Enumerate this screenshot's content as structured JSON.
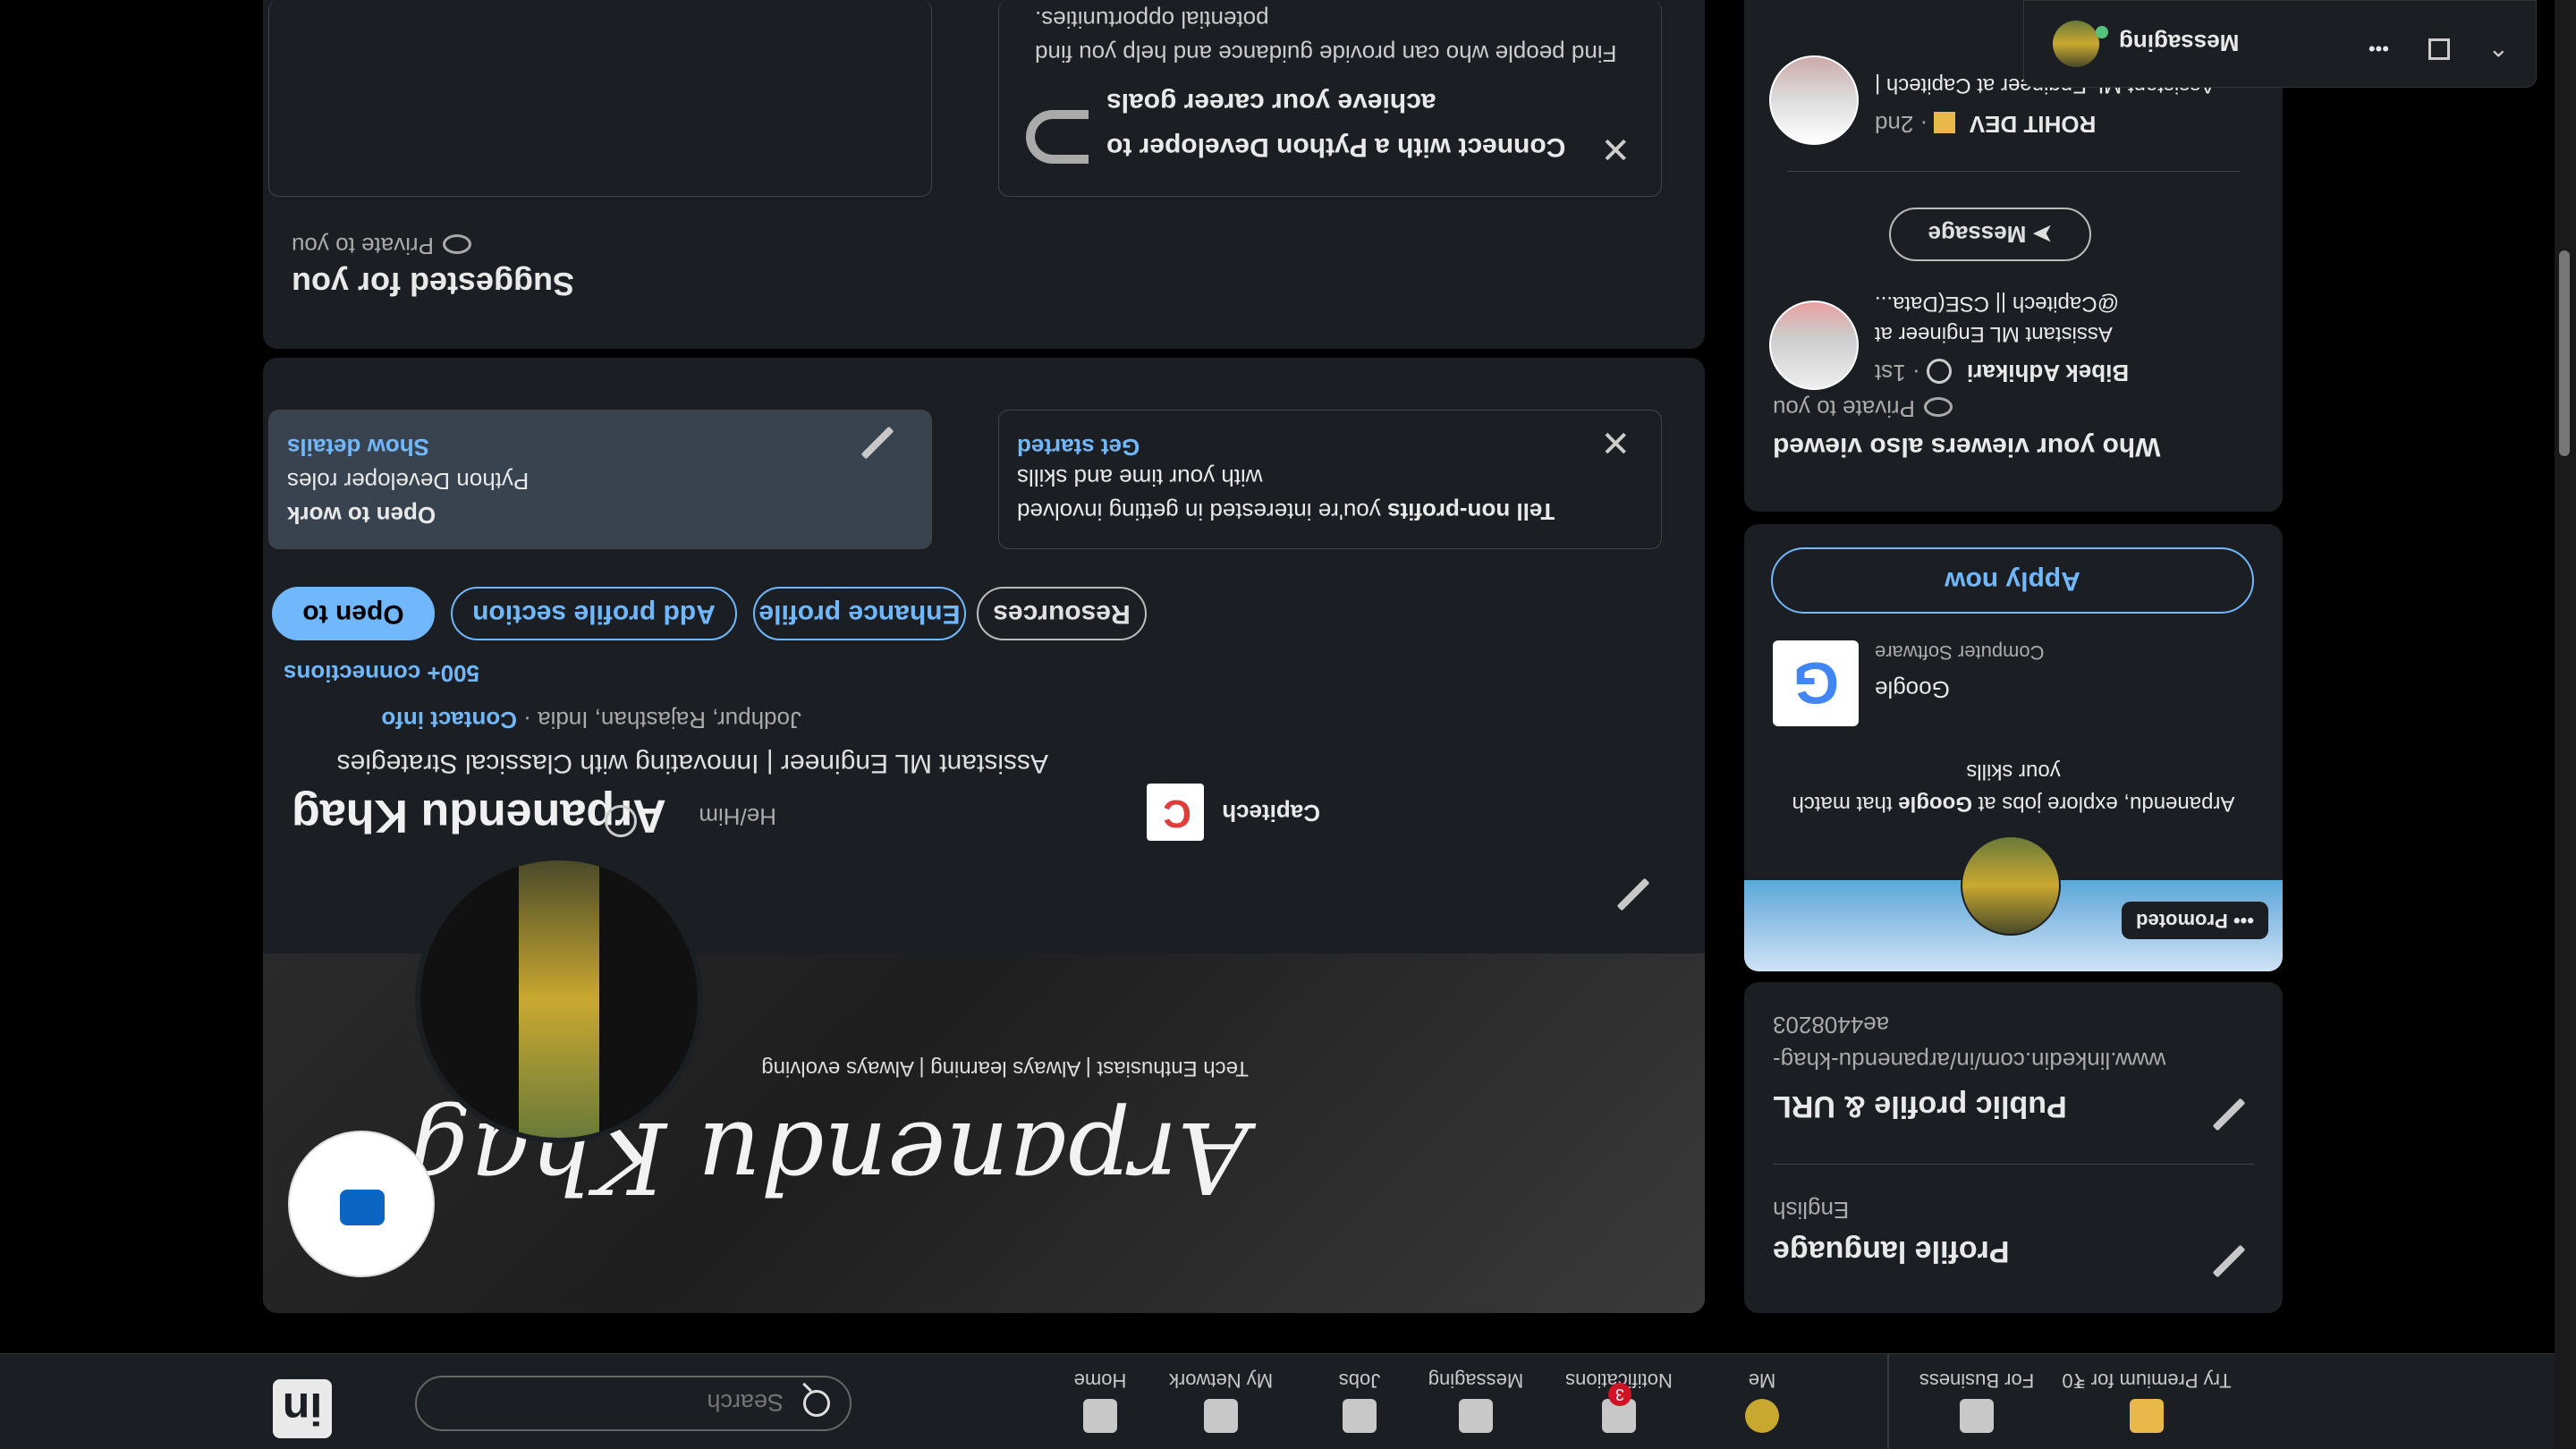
{
  "nav": {
    "search_placeholder": "Search",
    "items": [
      {
        "label": "Home",
        "icon": "home-icon"
      },
      {
        "label": "My Network",
        "icon": "network-icon"
      },
      {
        "label": "Jobs",
        "icon": "jobs-icon"
      },
      {
        "label": "Messaging",
        "icon": "messaging-icon"
      },
      {
        "label": "Notifications",
        "icon": "bell-icon",
        "badge": "3"
      },
      {
        "label": "Me",
        "icon": "avatar"
      },
      {
        "label": "For Business",
        "icon": "grid-icon"
      },
      {
        "label": "Try Premium for ₹0",
        "icon": "premium-icon"
      }
    ]
  },
  "profile": {
    "banner_tagline": "Tech Enthusiast | Always learning | Always evolving",
    "banner_signature": "Arpanendu Khag",
    "name": "Arpanendu Khag",
    "pronouns": "He/Him",
    "headline": "Assistant ML Engineer | Innovating with Classical Strategies",
    "location": "Jodhpur, Rajasthan, India",
    "contact_info": "Contact info",
    "connections": "500+ connections",
    "company": "Capitech",
    "buttons": {
      "open_to": "Open to",
      "add_section": "Add profile section",
      "enhance": "Enhance profile",
      "resources": "Resources"
    },
    "open_to_work": {
      "title": "Open to work",
      "roles": "Python Developer roles",
      "link": "Show details"
    },
    "nonprofit": {
      "text_bold": "Tell non-profits",
      "text_rest": " you're interested in getting involved with your time and skills",
      "link": "Get started"
    }
  },
  "suggested": {
    "title": "Suggested for you",
    "private": "Private to you",
    "connect_title": "Connect with a Python Developer to achieve your career goals",
    "connect_desc": "Find people who can provide guidance and help you find potential opportunities."
  },
  "sidebar": {
    "language": {
      "title": "Profile language",
      "value": "English"
    },
    "public_profile": {
      "title": "Public profile & URL",
      "url": "www.linkedin.com/in/arpanendu-khag-ae4408203"
    },
    "promo": {
      "label": "Promoted",
      "text_a": "Arpanendu, explore jobs at ",
      "text_bold": "Google",
      "text_b": " that match your skills",
      "company": "Google",
      "industry": "Computer Software",
      "apply": "Apply now"
    },
    "viewers": {
      "title": "Who your viewers also viewed",
      "private": "Private to you",
      "people": [
        {
          "name": "Bibek Adhikari",
          "degree": "· 1st",
          "headline": "Assistant ML Engineer at @Capitech || CSE(Data..."
        },
        {
          "name": "ROHIT DEV",
          "degree": "· 2nd",
          "headline": "Assistant ML Engineer at Capitech |"
        }
      ],
      "message_button": "Message"
    }
  },
  "messaging": {
    "label": "Messaging"
  }
}
